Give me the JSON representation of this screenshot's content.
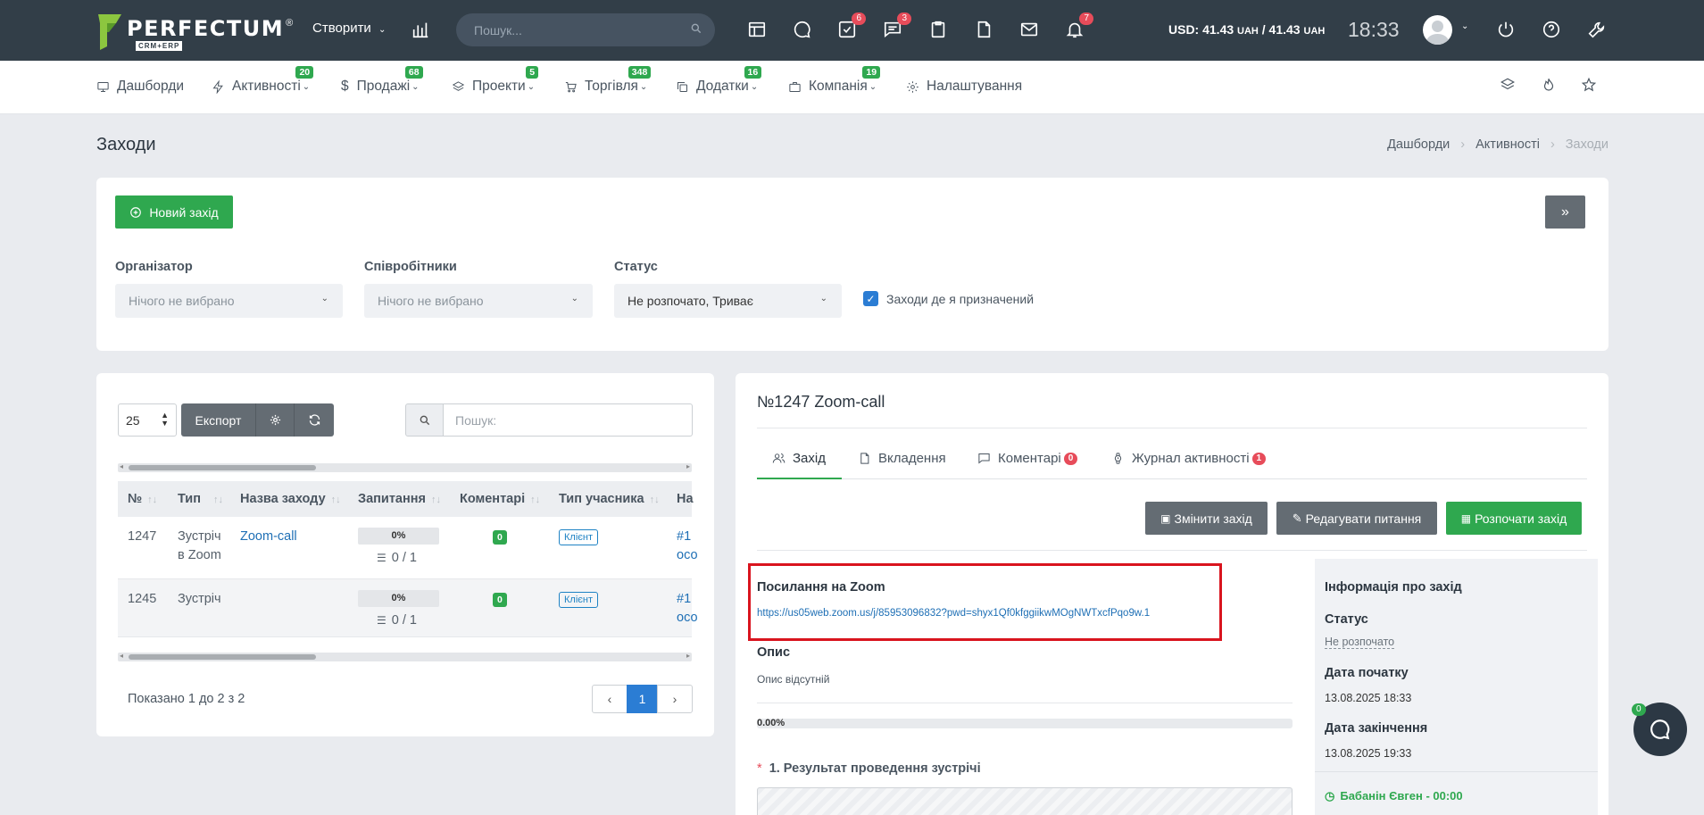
{
  "topbar": {
    "logo_text": "PERFECTUM",
    "logo_sub": "CRM+ERP",
    "create_label": "Створити",
    "search_placeholder": "Пошук...",
    "badges": {
      "tasks": "6",
      "chat": "3",
      "notifications": "7"
    },
    "usd_label": "USD: 41.43",
    "usd_unit1": "UAH",
    "usd_sep": "/ 41.43",
    "usd_unit2": "UAH",
    "time": "18:33"
  },
  "nav": {
    "items": [
      {
        "label": "Дашборди",
        "badge": ""
      },
      {
        "label": "Активності",
        "badge": "20"
      },
      {
        "label": "Продажі",
        "badge": "68"
      },
      {
        "label": "Проекти",
        "badge": "5"
      },
      {
        "label": "Торгівля",
        "badge": "348"
      },
      {
        "label": "Додатки",
        "badge": "16"
      },
      {
        "label": "Компанія",
        "badge": "19"
      },
      {
        "label": "Налаштування",
        "badge": ""
      }
    ]
  },
  "page": {
    "title": "Заходи",
    "breadcrumbs": [
      "Дашборди",
      "Активності",
      "Заходи"
    ]
  },
  "filters": {
    "new_button": "Новий захід",
    "toggle_button": "»",
    "organizer_label": "Організатор",
    "organizer_value": "Нічого не вибрано",
    "employees_label": "Співробітники",
    "employees_value": "Нічого не вибрано",
    "status_label": "Статус",
    "status_value": "Не розпочато, Триває",
    "assigned_label": "Заходи де я призначений"
  },
  "list": {
    "page_size": "25",
    "export_label": "Експорт",
    "search_placeholder": "Пошук:",
    "columns": [
      "№",
      "Тип",
      "Назва заходу",
      "Запитання",
      "Коментарі",
      "Тип учасника",
      "На"
    ],
    "rows": [
      {
        "num": "1247",
        "type1": "Зустріч",
        "type2": "в Zoom",
        "name": "Zoom-call",
        "pct": "0%",
        "questions": "0 / 1",
        "comments": "0",
        "participant": "Клієнт",
        "extra1": "#1",
        "extra2": "осо"
      },
      {
        "num": "1245",
        "type1": "Зустріч",
        "type2": "",
        "name": "",
        "pct": "0%",
        "questions": "0 / 1",
        "comments": "0",
        "participant": "Клієнт",
        "extra1": "#1",
        "extra2": "осо"
      }
    ],
    "summary": "Показано 1 до 2 з 2",
    "current_page": "1"
  },
  "detail": {
    "title": "№1247 Zoom-call",
    "tabs": [
      {
        "label": "Захід",
        "badge": ""
      },
      {
        "label": "Вкладення",
        "badge": ""
      },
      {
        "label": "Коментарі",
        "badge": "0"
      },
      {
        "label": "Журнал активності",
        "badge": "1"
      }
    ],
    "change_button": "Змінити захід",
    "edit_questions_button": "Редагувати питання",
    "start_button": "Розпочати захід",
    "zoom_label": "Посилання на Zoom",
    "zoom_link": "https://us05web.zoom.us/j/85953096832?pwd=shyx1Qf0kfggiikwMOgNWTxcfPqo9w.1",
    "description_label": "Опис",
    "description_value": "Опис відсутній",
    "progress_text": "0.00%",
    "progress_fraction": 0.0,
    "question_marker": "*",
    "question_1": "1. Результат проведення зустрічі"
  },
  "info": {
    "title": "Інформація про захід",
    "status_label": "Статус",
    "status_value": "Не розпочато",
    "start_label": "Дата початку",
    "start_value": "13.08.2025 18:33",
    "end_label": "Дата закінчення",
    "end_value": "13.08.2025 19:33",
    "participant": "Бабанін Євген - 00:00"
  },
  "chat": {
    "badge": "0"
  },
  "colors": {
    "topbar": "#323e48",
    "accent_green": "#2fa84f",
    "badge_red": "#e74c5a",
    "link": "#1e6fb5",
    "highlight": "#d9141e"
  }
}
